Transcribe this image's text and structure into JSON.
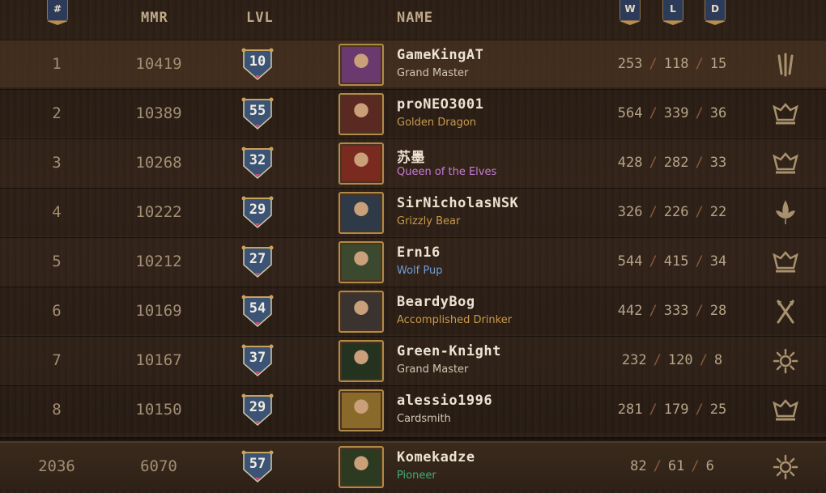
{
  "header": {
    "rank_badge": "#",
    "mmr": "MMR",
    "lvl": "LVL",
    "name": "NAME",
    "wins_badge": "W",
    "losses_badge": "L",
    "draws_badge": "D"
  },
  "rows": [
    {
      "rank": "1",
      "mmr": "10419",
      "level": "10",
      "name": "GameKingAT",
      "title": "Grand Master",
      "title_color": "#d2c6b2",
      "wins": "253",
      "losses": "118",
      "draws": "15",
      "faction_icon": "scoiatael-claw-icon",
      "avatar_color": "#6a3a6e"
    },
    {
      "rank": "2",
      "mmr": "10389",
      "level": "55",
      "name": "proNEO3001",
      "title": "Golden Dragon",
      "title_color": "#c99a4a",
      "wins": "564",
      "losses": "339",
      "draws": "36",
      "faction_icon": "nilfgaard-crest-icon",
      "avatar_color": "#5a2a22"
    },
    {
      "rank": "3",
      "mmr": "10268",
      "level": "32",
      "name": "苏墨",
      "title": "Queen of the Elves",
      "title_color": "#c77bd6",
      "wins": "428",
      "losses": "282",
      "draws": "33",
      "faction_icon": "nilfgaard-crest-icon",
      "avatar_color": "#7a2a1e"
    },
    {
      "rank": "4",
      "mmr": "10222",
      "level": "29",
      "name": "SirNicholasNSK",
      "title": "Grizzly Bear",
      "title_color": "#c99a4a",
      "wins": "326",
      "losses": "226",
      "draws": "22",
      "faction_icon": "northern-realms-lily-icon",
      "avatar_color": "#2e3a48"
    },
    {
      "rank": "5",
      "mmr": "10212",
      "level": "27",
      "name": "Ern16",
      "title": "Wolf Pup",
      "title_color": "#6f9fd6",
      "wins": "544",
      "losses": "415",
      "draws": "34",
      "faction_icon": "nilfgaard-crest-icon",
      "avatar_color": "#3b4a2e"
    },
    {
      "rank": "6",
      "mmr": "10169",
      "level": "54",
      "name": "BeardyBog",
      "title": "Accomplished Drinker",
      "title_color": "#c99a4a",
      "wins": "442",
      "losses": "333",
      "draws": "28",
      "faction_icon": "skellige-axes-icon",
      "avatar_color": "#3a3330"
    },
    {
      "rank": "7",
      "mmr": "10167",
      "level": "37",
      "name": "Green-Knight",
      "title": "Grand Master",
      "title_color": "#d2c6b2",
      "wins": "232",
      "losses": "120",
      "draws": "8",
      "faction_icon": "sun-icon",
      "avatar_color": "#24331f"
    },
    {
      "rank": "8",
      "mmr": "10150",
      "level": "29",
      "name": "alessio1996",
      "title": "Cardsmith",
      "title_color": "#d2c6b2",
      "wins": "281",
      "losses": "179",
      "draws": "25",
      "faction_icon": "nilfgaard-crest-icon",
      "avatar_color": "#8a6a2a"
    }
  ],
  "self_row": {
    "rank": "2036",
    "mmr": "6070",
    "level": "57",
    "name": "Komekadze",
    "title": "Pioneer",
    "title_color": "#3fae7d",
    "wins": "82",
    "losses": "61",
    "draws": "6",
    "faction_icon": "sun-icon",
    "avatar_color": "#2c3a22"
  }
}
